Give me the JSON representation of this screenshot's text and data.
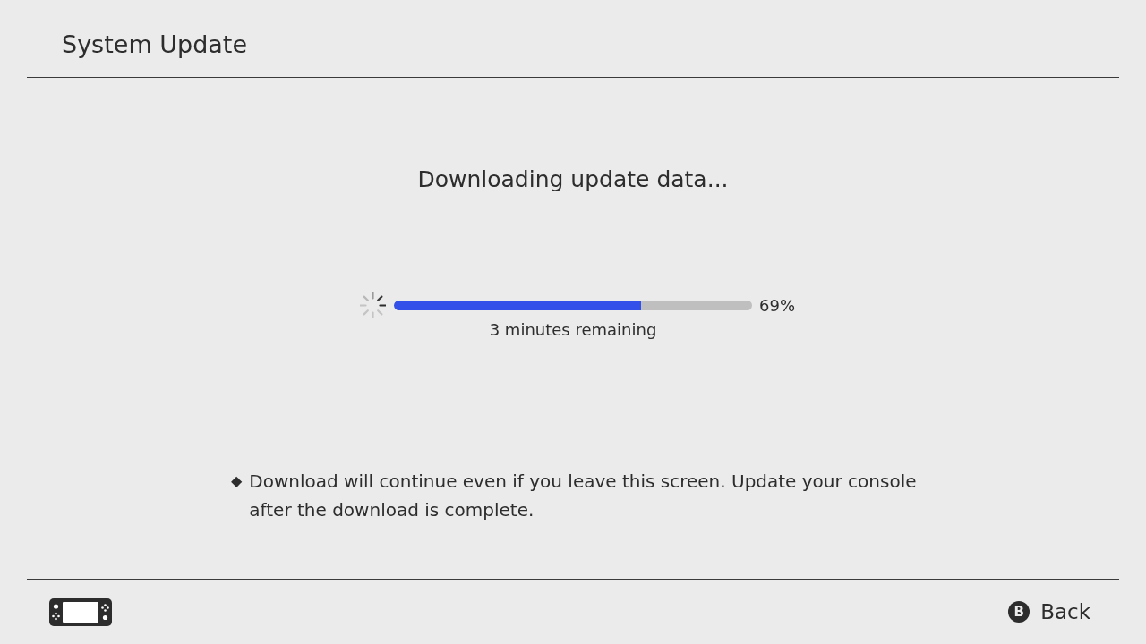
{
  "header": {
    "title": "System Update"
  },
  "status": {
    "heading": "Downloading update data..."
  },
  "progress": {
    "level": 0.69,
    "percent": "69%",
    "remaining": "3 minutes remaining"
  },
  "note": {
    "bullet": "◆",
    "text": "Download will continue even if you leave this screen. Update your console after the download is complete."
  },
  "footer": {
    "back": {
      "key": "B",
      "label": "Back"
    }
  }
}
